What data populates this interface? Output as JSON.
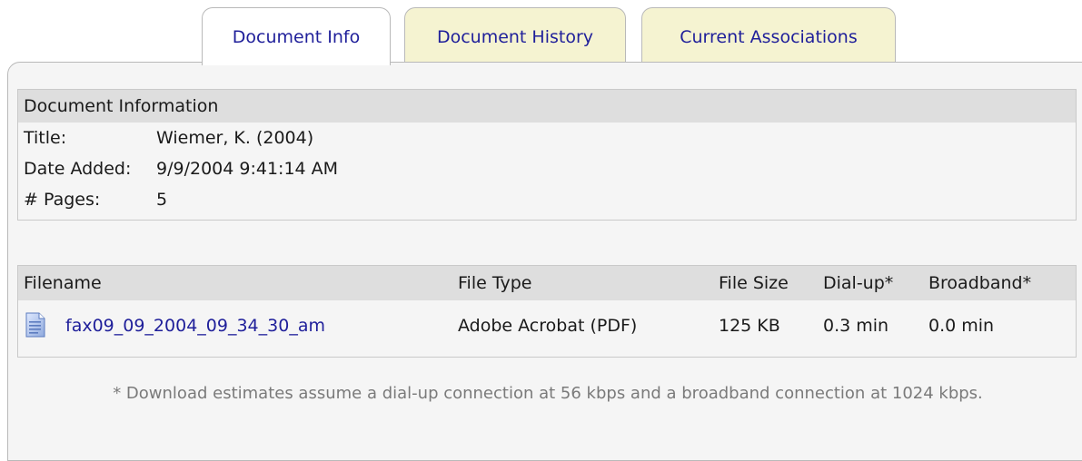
{
  "tabs": [
    {
      "label": "Document Info",
      "active": true
    },
    {
      "label": "Document History",
      "active": false
    },
    {
      "label": "Current Associations",
      "active": false
    }
  ],
  "info": {
    "header": "Document Information",
    "rows": [
      {
        "label": "Title:",
        "value": "Wiemer, K. (2004)"
      },
      {
        "label": "Date Added:",
        "value": "9/9/2004 9:41:14 AM"
      },
      {
        "label": "# Pages:",
        "value": "5"
      }
    ]
  },
  "files": {
    "columns": [
      "Filename",
      "File Type",
      "File Size",
      "Dial-up*",
      "Broadband*"
    ],
    "rows": [
      {
        "icon": "document-icon",
        "filename": "fax09_09_2004_09_34_30_am",
        "file_type": "Adobe Acrobat (PDF)",
        "file_size": "125 KB",
        "dialup": "0.3 min",
        "broadband": "0.0 min"
      }
    ]
  },
  "footnote": "* Download estimates assume a dial-up connection at 56 kbps and a broadband connection at 1024 kbps.",
  "colors": {
    "tab_inactive_bg": "#f5f3d1",
    "link": "#1f1f9a",
    "panel_bg": "#f5f5f5",
    "header_bg": "#dedede"
  }
}
